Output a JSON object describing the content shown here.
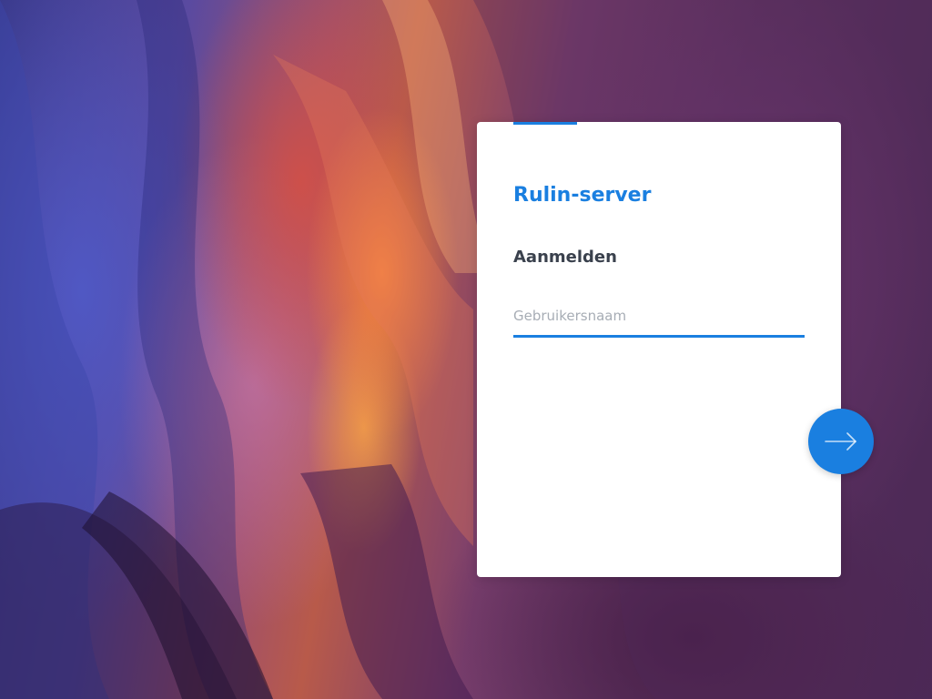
{
  "login": {
    "server_name": "Rulin-server",
    "section_title": "Aanmelden",
    "username": {
      "value": "",
      "placeholder": "Gebruikersnaam"
    },
    "next_button_icon": "arrow-right-icon"
  },
  "background": {
    "description_icon": "wallpaper-canyon-image"
  },
  "colors": {
    "accent": "#1a7fe0",
    "title_text": "#3a414d",
    "placeholder": "#a7adb5",
    "card_bg": "#ffffff"
  }
}
